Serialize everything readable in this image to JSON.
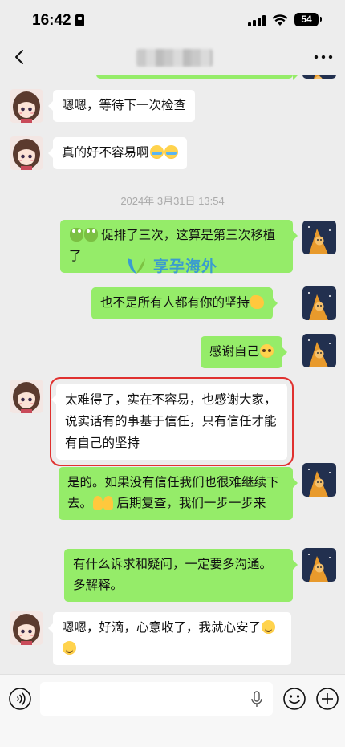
{
  "status_bar": {
    "time": "16:42",
    "battery": "54"
  },
  "header": {
    "title": "",
    "back_icon": "chevron-left-icon",
    "more_icon": "ellipsis-icon"
  },
  "timestamp": "2024年 3月31日 13:54",
  "messages": [
    {
      "side": "left",
      "text": "嗯嗯，等待下一次检查"
    },
    {
      "side": "left",
      "text": "真的好不容易啊",
      "emoji": [
        "loudly-crying-face",
        "loudly-crying-face"
      ]
    },
    {
      "side": "right",
      "emoji_before": [
        "frog",
        "frog"
      ],
      "text": " 促排了三次，这算是第三次移植了"
    },
    {
      "side": "right",
      "text": "也不是所有人都有你的坚持",
      "emoji": [
        "flexed-biceps"
      ]
    },
    {
      "side": "right",
      "text": "感谢自己",
      "emoji": [
        "pleading-face"
      ]
    },
    {
      "side": "left",
      "text": "太难得了，实在不容易，也感谢大家，说实话有的事基于信任，只有信任才能有自己的坚持",
      "highlighted": true
    },
    {
      "side": "right",
      "text_before": "是的。如果没有信任我们也很难继续下去。",
      "emoji": [
        "folded-hands",
        "folded-hands"
      ],
      "text_after": " 后期复查，我们一步一步来"
    },
    {
      "side": "right",
      "text": "有什么诉求和疑问，一定要多沟通。多解释。"
    },
    {
      "side": "left",
      "text": "嗯嗯，好滴，心意收了，我就心安了",
      "emoji": [
        "smiling-face",
        "smiling-face"
      ]
    }
  ],
  "watermark": {
    "text": "享孕海外"
  },
  "input_bar": {
    "placeholder": "",
    "voice_icon": "voice-icon",
    "mic_icon": "microphone-icon",
    "emoji_icon": "smiley-icon",
    "plus_icon": "plus-icon"
  },
  "colors": {
    "sent_bubble": "#95ec69",
    "received_bubble": "#ffffff",
    "background": "#ededed",
    "highlight_box": "#e0312f"
  }
}
